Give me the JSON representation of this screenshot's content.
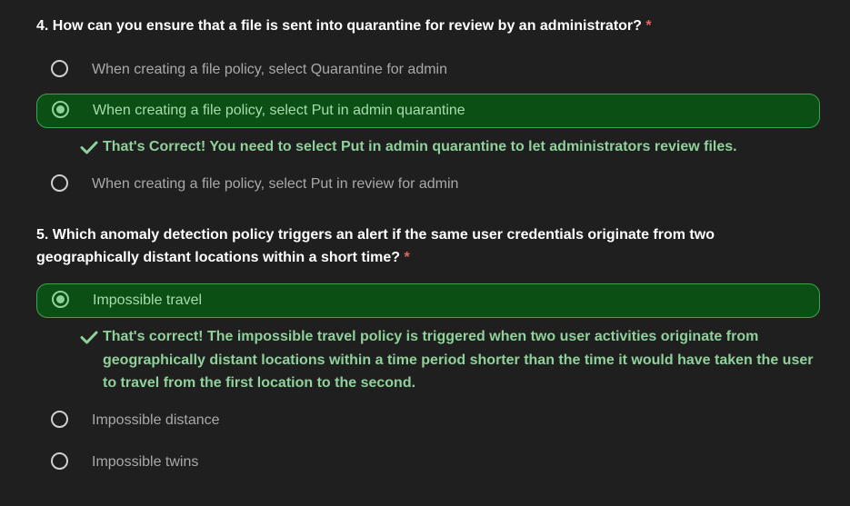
{
  "q4": {
    "title": "4. How can you ensure that a file is sent into quarantine for review by an administrator?",
    "required_mark": "*",
    "options": [
      {
        "label": "When creating a file policy, select Quarantine for admin"
      },
      {
        "label": "When creating a file policy, select Put in admin quarantine"
      },
      {
        "label": "When creating a file policy, select Put in review for admin"
      }
    ],
    "feedback": "That's Correct! You need to select Put in admin quarantine to let administrators review files."
  },
  "q5": {
    "title": "5. Which anomaly detection policy triggers an alert if the same user credentials originate from two geographically distant locations within a short time?",
    "required_mark": "*",
    "options": [
      {
        "label": "Impossible travel"
      },
      {
        "label": "Impossible distance"
      },
      {
        "label": "Impossible twins"
      }
    ],
    "feedback": "That's correct! The impossible travel policy is triggered when two user activities originate from geographically distant locations within a time period shorter than the time it would have taken the user to travel from the first location to the second."
  },
  "colors": {
    "background": "#1f1f1f",
    "selected_fill": "#0b4f14",
    "selected_border": "#3fa34d",
    "correct_text": "#8fd19a",
    "required_mark": "#e06666"
  },
  "icons": {
    "radio": "radio-circle-icon",
    "check": "check-icon"
  }
}
